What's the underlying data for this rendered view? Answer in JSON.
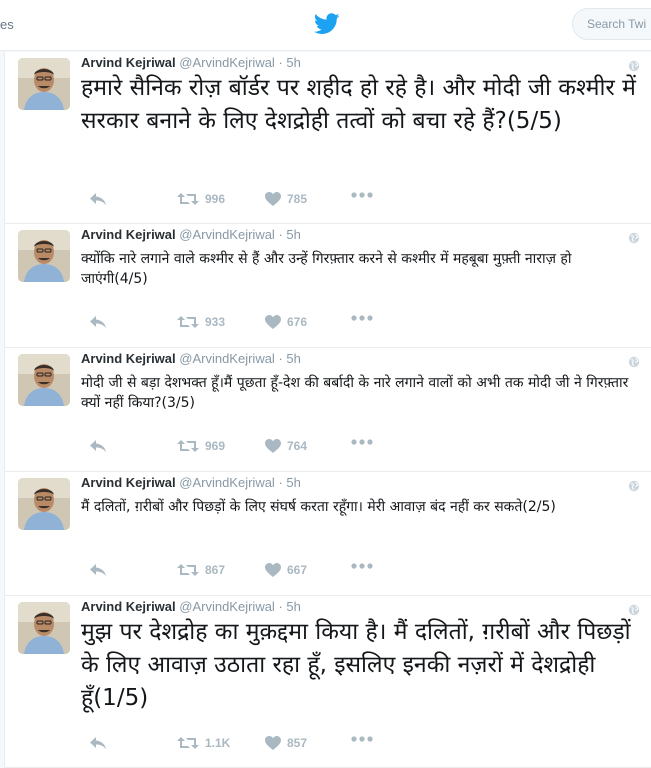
{
  "topbar": {
    "left_fragment": "es",
    "search_placeholder": "Search Twi"
  },
  "colors": {
    "brand": "#1da1f2",
    "icon_gray": "#aab8c2",
    "meta_gray": "#8899a6"
  },
  "tweets": [
    {
      "name": "Arvind Kejriwal",
      "handle": "@ArvindKejriwal",
      "sep": "·",
      "time": "5h",
      "text": "हमारे सैनिक रोज़ बॉर्डर पर शहीद हो रहे है। और मोदी जी कश्मीर में सरकार बनाने के लिए देशद्रोही तत्वों को बचा रहे हैं?(5/5)",
      "retweets": "996",
      "likes": "785"
    },
    {
      "name": "Arvind Kejriwal",
      "handle": "@ArvindKejriwal",
      "sep": "·",
      "time": "5h",
      "text": "क्योंकि नारे लगाने वाले कश्मीर से हैं और उन्हें गिरफ़्तार करने से कश्मीर में महबूबा मुफ़्ती नाराज़ हो जाएंगी(4/5)",
      "retweets": "933",
      "likes": "676"
    },
    {
      "name": "Arvind Kejriwal",
      "handle": "@ArvindKejriwal",
      "sep": "·",
      "time": "5h",
      "text": "मोदी जी से बड़ा देशभक्त हूँ।मैं पूछता हूँ-देश की बर्बादी के नारे लगाने वालों को अभी तक मोदी जी ने गिरफ़्तार क्यों नहीं किया?(3/5)",
      "retweets": "969",
      "likes": "764"
    },
    {
      "name": "Arvind Kejriwal",
      "handle": "@ArvindKejriwal",
      "sep": "·",
      "time": "5h",
      "text": "मैं दलितों, ग़रीबों और पिछड़ों के लिए संघर्ष करता रहूँगा। मेरी आवाज़ बंद नहीं कर सकते(2/5)",
      "retweets": "867",
      "likes": "667"
    },
    {
      "name": "Arvind Kejriwal",
      "handle": "@ArvindKejriwal",
      "sep": "·",
      "time": "5h",
      "text": "मुझ पर देशद्रोह का मुक़द्दमा किया है। मैं दलितों, ग़रीबों और पिछड़ों के लिए आवाज़ उठाता रहा हूँ, इसलिए इनकी नज़रों में देशद्रोही हूँ(1/5)",
      "retweets": "1.1K",
      "likes": "857"
    }
  ]
}
